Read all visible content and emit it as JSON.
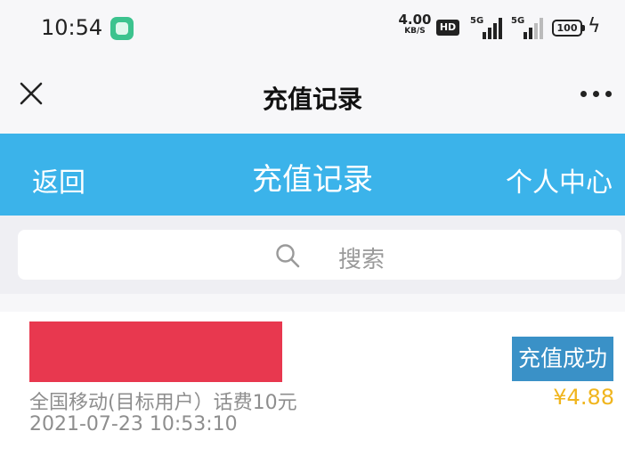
{
  "status_bar": {
    "time": "10:54",
    "net_speed": "4.00",
    "net_speed_unit": "KB/S",
    "hd_label": "HD",
    "sim1_label": "5G",
    "sim2_label": "5G",
    "battery": "100"
  },
  "top_nav": {
    "title": "充值记录"
  },
  "blue_bar": {
    "back_label": "返回",
    "title": "充值记录",
    "user_center_label": "个人中心"
  },
  "search": {
    "placeholder": "搜索"
  },
  "record": {
    "description": "全国移动(目标用户）话费10元",
    "time": "2021-07-23 10:53:10",
    "status": "充值成功",
    "amount": "¥4.88"
  },
  "colors": {
    "accent_blue": "#3bb3ea",
    "badge_blue": "#3a91c7",
    "amount_yellow": "#f0b51e",
    "redaction_red": "#e8384f"
  }
}
